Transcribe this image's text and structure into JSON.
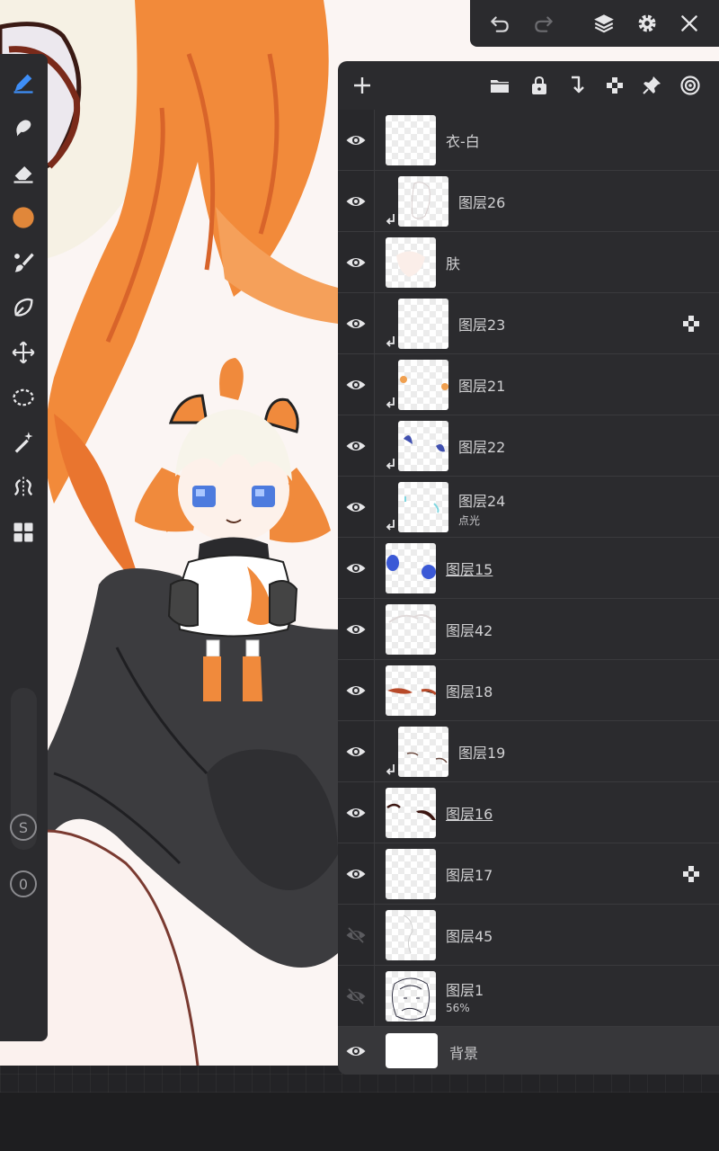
{
  "top_toolbar": {
    "icons": [
      "undo-icon",
      "redo-icon",
      "layers-icon",
      "gear-icon",
      "close-icon"
    ]
  },
  "left_tools": {
    "icons": [
      "pen-icon",
      "smudge-icon",
      "eraser-icon",
      "color-swatch-icon",
      "brush-icon",
      "lasso-fill-icon",
      "move-icon",
      "lasso-select-icon",
      "magic-wand-icon",
      "symmetry-icon",
      "panels-icon"
    ],
    "active_tool": "pen-icon",
    "current_color": "#e0873a",
    "size_button": "S",
    "opacity_button": "0"
  },
  "layers_header": {
    "icons": [
      "add-layer-icon",
      "folder-icon",
      "lock-icon",
      "merge-down-icon",
      "alpha-lock-icon",
      "pin-icon",
      "reference-icon"
    ]
  },
  "layers": [
    {
      "name": "衣-白",
      "visible": true,
      "clipped": false,
      "underline": false,
      "sub": "",
      "alpha_lock": false
    },
    {
      "name": "图层26",
      "visible": true,
      "clipped": true,
      "underline": false,
      "sub": "",
      "alpha_lock": false
    },
    {
      "name": "肤",
      "visible": true,
      "clipped": false,
      "underline": false,
      "sub": "",
      "alpha_lock": false
    },
    {
      "name": "图层23",
      "visible": true,
      "clipped": true,
      "underline": false,
      "sub": "",
      "alpha_lock": true
    },
    {
      "name": "图层21",
      "visible": true,
      "clipped": true,
      "underline": false,
      "sub": "",
      "alpha_lock": false
    },
    {
      "name": "图层22",
      "visible": true,
      "clipped": true,
      "underline": false,
      "sub": "",
      "alpha_lock": false
    },
    {
      "name": "图层24",
      "visible": true,
      "clipped": true,
      "underline": false,
      "sub": "点光",
      "alpha_lock": false
    },
    {
      "name": "图层15",
      "visible": true,
      "clipped": false,
      "underline": true,
      "sub": "",
      "alpha_lock": false
    },
    {
      "name": "图层42",
      "visible": true,
      "clipped": false,
      "underline": false,
      "sub": "",
      "alpha_lock": false
    },
    {
      "name": "图层18",
      "visible": true,
      "clipped": false,
      "underline": false,
      "sub": "",
      "alpha_lock": false
    },
    {
      "name": "图层19",
      "visible": true,
      "clipped": true,
      "underline": false,
      "sub": "",
      "alpha_lock": false
    },
    {
      "name": "图层16",
      "visible": true,
      "clipped": false,
      "underline": true,
      "sub": "",
      "alpha_lock": false
    },
    {
      "name": "图层17",
      "visible": true,
      "clipped": false,
      "underline": false,
      "sub": "",
      "alpha_lock": true
    },
    {
      "name": "图层45",
      "visible": false,
      "clipped": false,
      "underline": false,
      "sub": "",
      "alpha_lock": false
    },
    {
      "name": "图层1",
      "visible": false,
      "clipped": false,
      "underline": false,
      "sub": "56%",
      "alpha_lock": false
    }
  ],
  "background_layer": {
    "name": "背景",
    "visible": true
  },
  "colors": {
    "panel": "#2b2b2e",
    "accent_active_tool": "#3e8ef7",
    "hair_orange": "#f08a3c",
    "sleeve_black": "#3b3b3e"
  }
}
